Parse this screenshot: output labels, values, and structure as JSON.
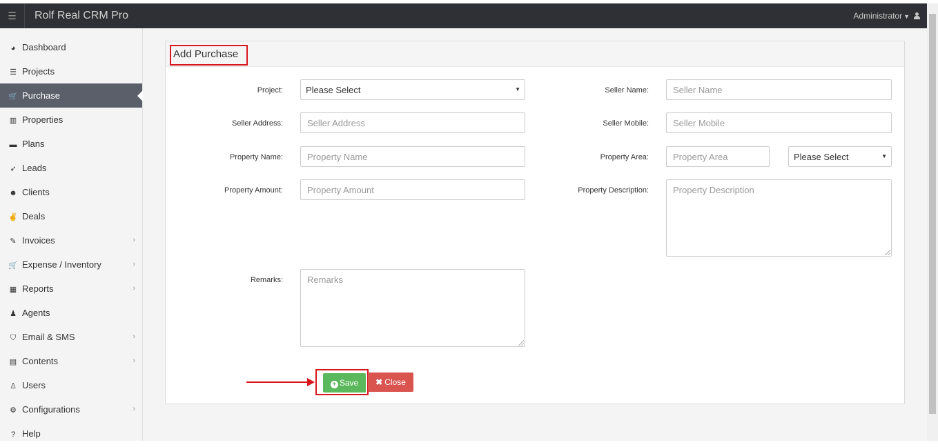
{
  "app": {
    "title": "Rolf Real CRM Pro",
    "user": "Administrator"
  },
  "sidebar": {
    "items": [
      {
        "label": "Dashboard",
        "icon": "dashboard-icon",
        "glyph": "◕",
        "chevron": false,
        "active": false
      },
      {
        "label": "Projects",
        "icon": "server-icon",
        "glyph": "☰",
        "chevron": false,
        "active": false
      },
      {
        "label": "Purchase",
        "icon": "cart-icon",
        "glyph": "🛒",
        "chevron": false,
        "active": true
      },
      {
        "label": "Properties",
        "icon": "building-icon",
        "glyph": "▥",
        "chevron": false,
        "active": false
      },
      {
        "label": "Plans",
        "icon": "briefcase-icon",
        "glyph": "▬",
        "chevron": false,
        "active": false
      },
      {
        "label": "Leads",
        "icon": "rocket-icon",
        "glyph": "➶",
        "chevron": false,
        "active": false
      },
      {
        "label": "Clients",
        "icon": "users-icon",
        "glyph": "☻",
        "chevron": false,
        "active": false
      },
      {
        "label": "Deals",
        "icon": "thumbs-up-icon",
        "glyph": "✌",
        "chevron": false,
        "active": false
      },
      {
        "label": "Invoices",
        "icon": "pushpin-icon",
        "glyph": "✎",
        "chevron": true,
        "active": false
      },
      {
        "label": "Expense / Inventory",
        "icon": "cart-icon",
        "glyph": "🛒",
        "chevron": true,
        "active": false
      },
      {
        "label": "Reports",
        "icon": "table-icon",
        "glyph": "▦",
        "chevron": true,
        "active": false
      },
      {
        "label": "Agents",
        "icon": "user-secret-icon",
        "glyph": "♟",
        "chevron": false,
        "active": false
      },
      {
        "label": "Email & SMS",
        "icon": "shield-icon",
        "glyph": "⛉",
        "chevron": true,
        "active": false
      },
      {
        "label": "Contents",
        "icon": "newspaper-icon",
        "glyph": "▤",
        "chevron": true,
        "active": false
      },
      {
        "label": "Users",
        "icon": "user-icon",
        "glyph": "♙",
        "chevron": false,
        "active": false
      },
      {
        "label": "Configurations",
        "icon": "cogs-icon",
        "glyph": "⚙",
        "chevron": true,
        "active": false
      },
      {
        "label": "Help",
        "icon": "question-circle-icon",
        "glyph": "?",
        "chevron": false,
        "active": false
      }
    ]
  },
  "form": {
    "title": "Add Purchase",
    "project_label": "Project:",
    "project_value": "Please Select",
    "seller_name_label": "Seller Name:",
    "seller_name_placeholder": "Seller Name",
    "seller_address_label": "Seller Address:",
    "seller_address_placeholder": "Seller Address",
    "seller_mobile_label": "Seller Mobile:",
    "seller_mobile_placeholder": "Seller Mobile",
    "property_name_label": "Property Name:",
    "property_name_placeholder": "Property Name",
    "property_area_label": "Property Area:",
    "property_area_placeholder": "Property Area",
    "property_area_unit_value": "Please Select",
    "property_amount_label": "Property Amount:",
    "property_amount_placeholder": "Property Amount",
    "property_description_label": "Property Description:",
    "property_description_placeholder": "Property Description",
    "remarks_label": "Remarks:",
    "remarks_placeholder": "Remarks",
    "save_label": "Save",
    "close_label": "Close"
  },
  "colors": {
    "topbar": "#2e3035",
    "active_nav": "#5a5f6a",
    "save": "#5cb85c",
    "close": "#d9534f",
    "annotation": "#d9161e"
  }
}
